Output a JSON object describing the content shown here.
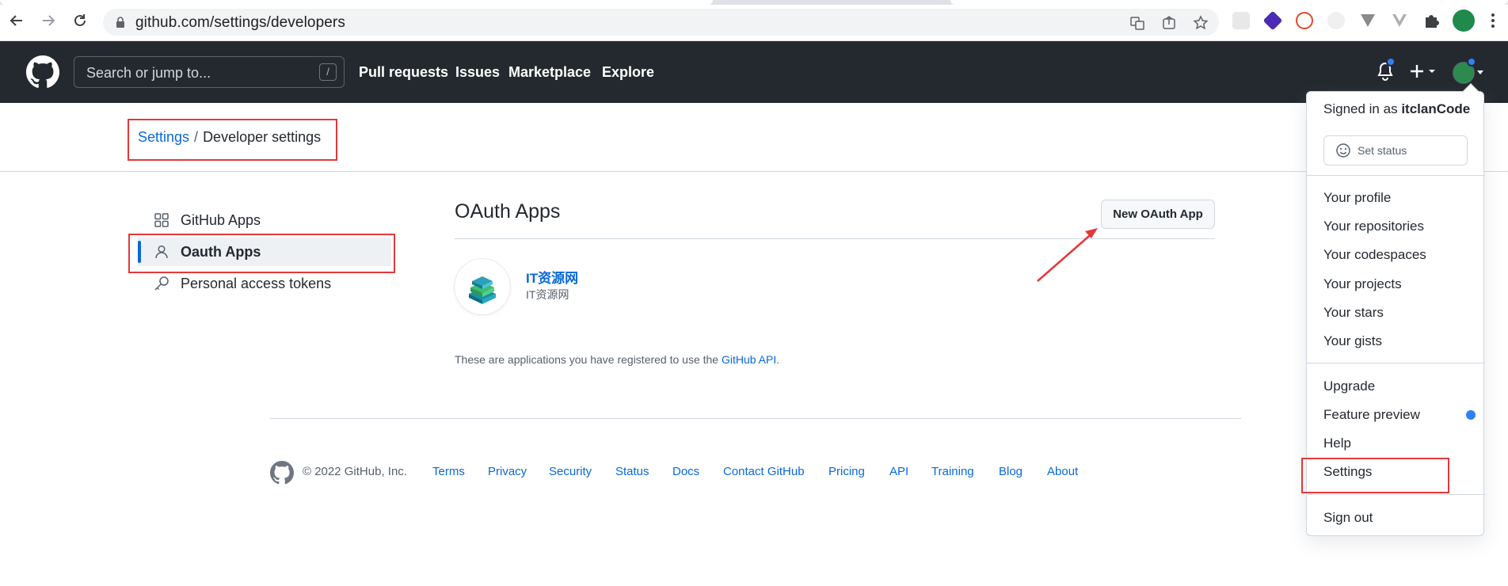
{
  "browser": {
    "url": "github.com/settings/developers"
  },
  "header": {
    "search_placeholder": "Search or jump to...",
    "search_shortcut": "/",
    "nav": [
      "Pull requests",
      "Issues",
      "Marketplace",
      "Explore"
    ]
  },
  "breadcrumb": {
    "parent": "Settings",
    "separator": "/",
    "current": "Developer settings"
  },
  "sidebar": {
    "items": [
      {
        "label": "GitHub Apps",
        "icon": "apps-grid-icon"
      },
      {
        "label": "Oauth Apps",
        "icon": "person-icon",
        "active": true
      },
      {
        "label": "Personal access tokens",
        "icon": "key-icon"
      }
    ]
  },
  "main": {
    "title": "OAuth Apps",
    "new_button": "New OAuth App",
    "app": {
      "name": "IT资源网",
      "description": "IT资源网"
    },
    "info_prefix": "These are applications you have registered to use the ",
    "info_link": "GitHub API",
    "info_suffix": "."
  },
  "footer": {
    "copyright": "© 2022 GitHub, Inc.",
    "links": [
      "Terms",
      "Privacy",
      "Security",
      "Status",
      "Docs",
      "Contact GitHub",
      "Pricing",
      "API",
      "Training",
      "Blog",
      "About"
    ]
  },
  "dropdown": {
    "signed_in_prefix": "Signed in as",
    "username": "itclanCode",
    "set_status": "Set status",
    "group1": [
      "Your profile",
      "Your repositories",
      "Your codespaces",
      "Your projects",
      "Your stars",
      "Your gists"
    ],
    "group2": [
      "Upgrade",
      "Feature preview",
      "Help",
      "Settings"
    ],
    "sign_out": "Sign out"
  },
  "colors": {
    "annotation_red": "#e5383b",
    "link_blue": "#0969da",
    "header_dark": "#24292f",
    "notification_blue": "#2f81f7"
  }
}
